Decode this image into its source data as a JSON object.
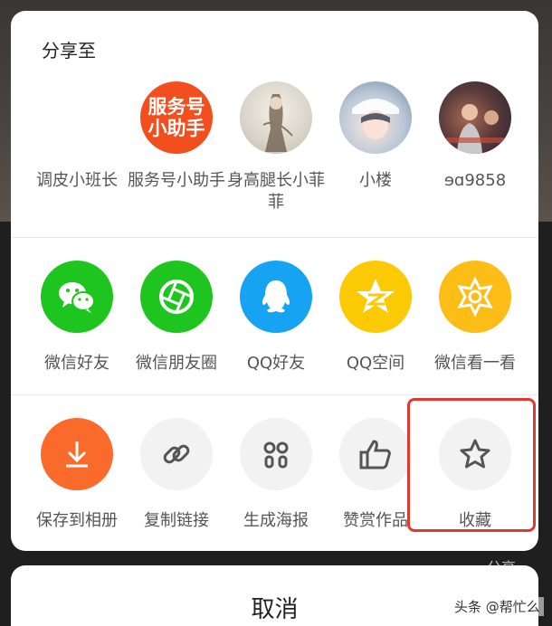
{
  "background": {
    "hint_text": "分享"
  },
  "share_sheet": {
    "title": "分享至",
    "contacts": [
      {
        "name": "调皮小班长",
        "avatar_text": ""
      },
      {
        "name": "服务号小助手",
        "avatar_text_line1": "服务号",
        "avatar_text_line2": "小助手"
      },
      {
        "name": "身高腿长小菲菲"
      },
      {
        "name": "小楼"
      },
      {
        "name": "ɘɑ9858"
      }
    ],
    "apps": [
      {
        "label": "微信好友",
        "icon": "wechat-icon",
        "color": "#1ec51e"
      },
      {
        "label": "微信朋友圈",
        "icon": "moments-icon",
        "color": "#1ec51e"
      },
      {
        "label": "QQ好友",
        "icon": "qq-icon",
        "color": "#15a3f2"
      },
      {
        "label": "QQ空间",
        "icon": "qzone-icon",
        "color": "#fcca05"
      },
      {
        "label": "微信看一看",
        "icon": "look-icon",
        "color": "#fcbd17"
      }
    ],
    "actions": [
      {
        "label": "保存到相册",
        "icon": "download-icon",
        "color": "#fa6b2b"
      },
      {
        "label": "复制链接",
        "icon": "link-icon"
      },
      {
        "label": "生成海报",
        "icon": "poster-icon"
      },
      {
        "label": "赞赏作品",
        "icon": "thumbs-up-icon"
      },
      {
        "label": "收藏",
        "icon": "star-icon"
      }
    ],
    "highlight_color": "#e03a2e"
  },
  "cancel": {
    "label": "取消"
  },
  "watermark": {
    "text": "头条 @帮忙么"
  }
}
